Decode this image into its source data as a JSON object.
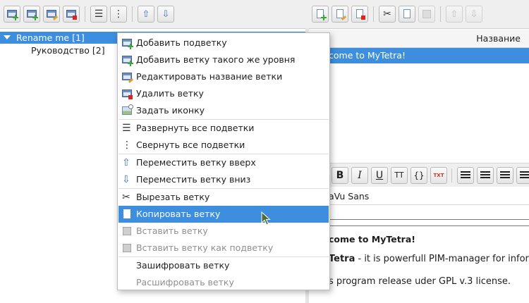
{
  "tree": {
    "root_label": "Rename me [1]",
    "child_label": "Руководство [2]"
  },
  "notes_table": {
    "column_name": "Название",
    "row_title": "come to MyTetra!"
  },
  "editor": {
    "font_name": "aVu Sans",
    "format_buttons": {
      "bold": "B",
      "italic": "I",
      "underline": "U",
      "monospace": "TT",
      "code": "{}",
      "clear_format": "TXT"
    },
    "heading": "come to MyTetra!",
    "line1_bold": "Tetra",
    "line1_rest": " - it is powerfull PIM-manager for infor",
    "line2": "s program release uder GPL v.3 license."
  },
  "context_menu": {
    "items": [
      {
        "label": "Добавить подветку",
        "icon": "add-subbranch-icon",
        "state": "normal"
      },
      {
        "label": "Добавить ветку такого же уровня",
        "icon": "add-sibling-branch-icon",
        "state": "normal"
      },
      {
        "label": "Редактировать название ветки",
        "icon": "edit-branch-name-icon",
        "state": "normal"
      },
      {
        "label": "Удалить ветку",
        "icon": "delete-branch-icon",
        "state": "normal"
      },
      {
        "label": "Задать иконку",
        "icon": "set-icon-icon",
        "state": "normal"
      },
      {
        "label": "Развернуть все подветки",
        "icon": "expand-all-icon",
        "state": "normal"
      },
      {
        "label": "Свернуть все подветки",
        "icon": "collapse-all-icon",
        "state": "normal"
      },
      {
        "label": "Переместить ветку вверх",
        "icon": "arrow-up-icon",
        "state": "normal"
      },
      {
        "label": "Переместить ветку вниз",
        "icon": "arrow-down-icon",
        "state": "normal"
      },
      {
        "label": "Вырезать ветку",
        "icon": "cut-icon",
        "state": "normal"
      },
      {
        "label": "Копировать ветку",
        "icon": "copy-icon",
        "state": "selected"
      },
      {
        "label": "Вставить ветку",
        "icon": "paste-icon",
        "state": "disabled"
      },
      {
        "label": "Вставить ветку как подветку",
        "icon": "paste-as-subbranch-icon",
        "state": "disabled"
      },
      {
        "label": "Зашифровать ветку",
        "icon": "",
        "state": "normal"
      },
      {
        "label": "Расшифровать ветку",
        "icon": "",
        "state": "disabled"
      }
    ]
  },
  "colors": {
    "selection": "#3d8ede",
    "background": "#efefef",
    "disabled_text": "#8f8f8f"
  }
}
